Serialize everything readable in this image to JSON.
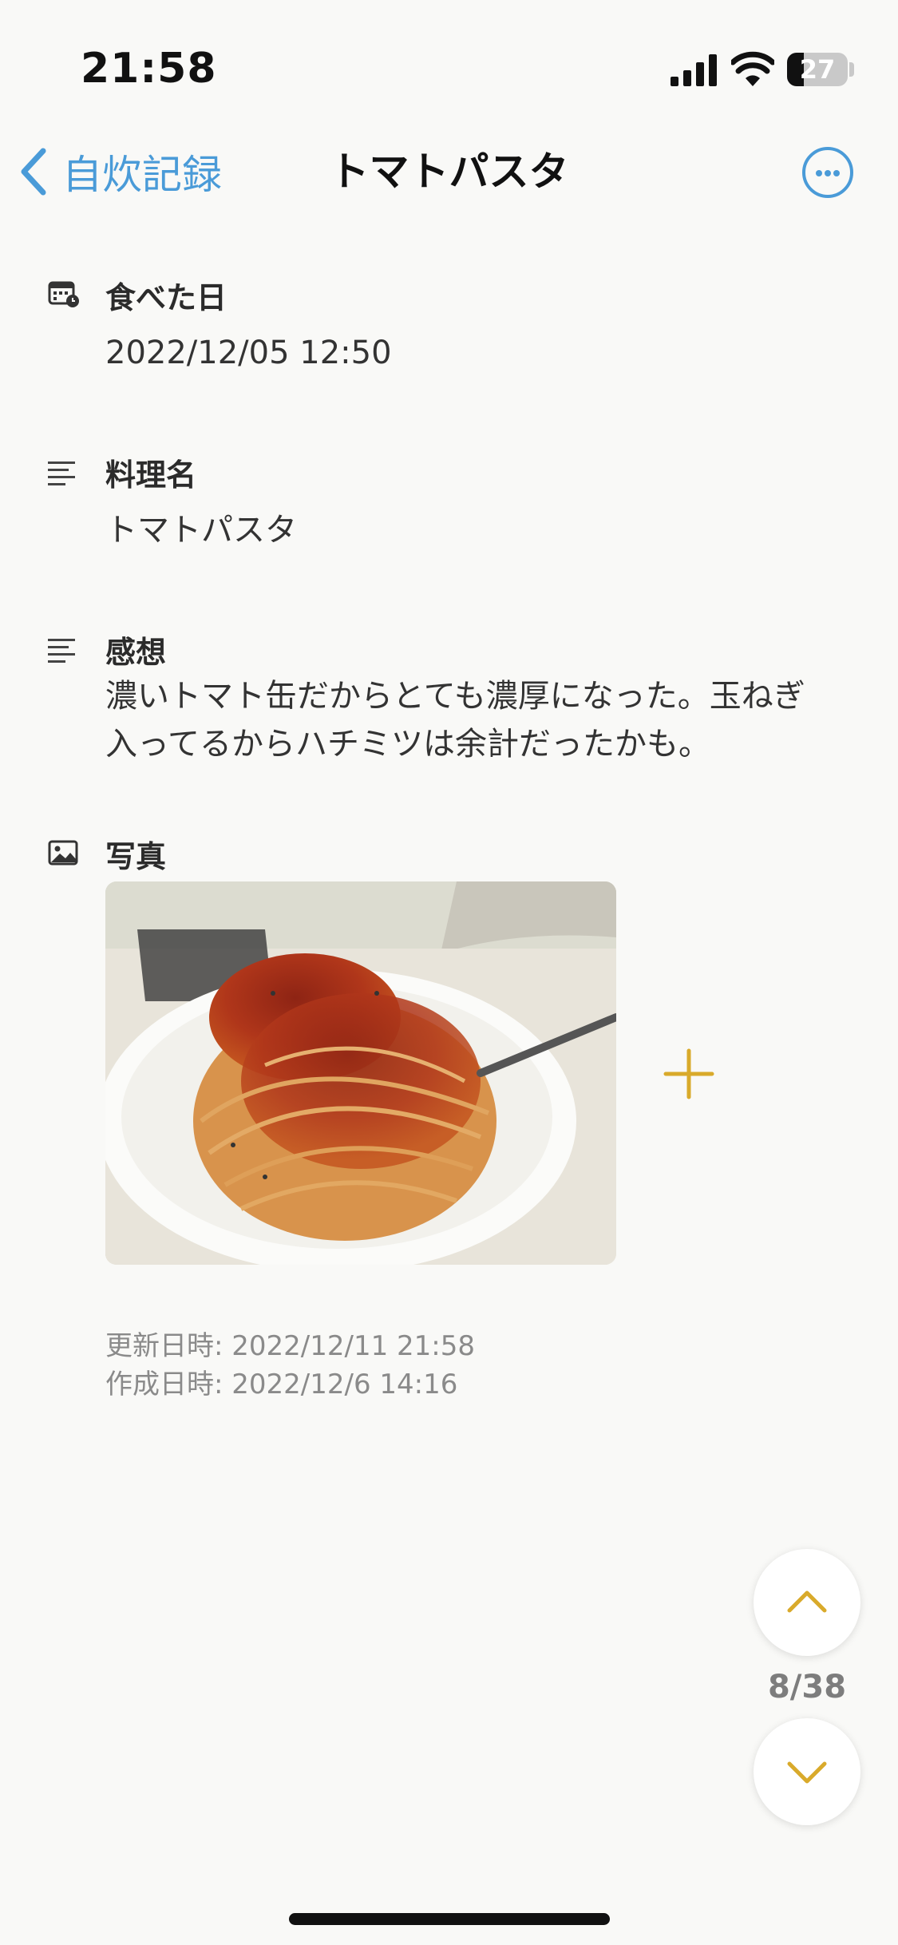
{
  "status_bar": {
    "time": "21:58",
    "battery_level": "27",
    "battery_fraction": 0.27
  },
  "nav": {
    "back_label": "自炊記録",
    "title": "トマトパスタ"
  },
  "fields": {
    "date": {
      "label": "食べた日",
      "value": "2022/12/05 12:50",
      "icon": "calendar-clock-icon"
    },
    "dish": {
      "label": "料理名",
      "value": "トマトパスタ",
      "icon": "text-lines-icon"
    },
    "impression": {
      "label": "感想",
      "lines": [
        "濃いトマト缶だからとても濃厚になった。玉ねぎ",
        "入ってるからハチミツは余計だったかも。"
      ],
      "icon": "text-lines-icon"
    },
    "photo": {
      "label": "写真",
      "icon": "image-icon"
    }
  },
  "meta": {
    "updated": "更新日時: 2022/12/11 21:58",
    "created": "作成日時: 2022/12/6 14:16"
  },
  "pager": {
    "counter": "8/38"
  },
  "colors": {
    "accent_blue": "#4a9bd8",
    "accent_gold": "#d9aa2b",
    "background": "#f9f9f7"
  }
}
